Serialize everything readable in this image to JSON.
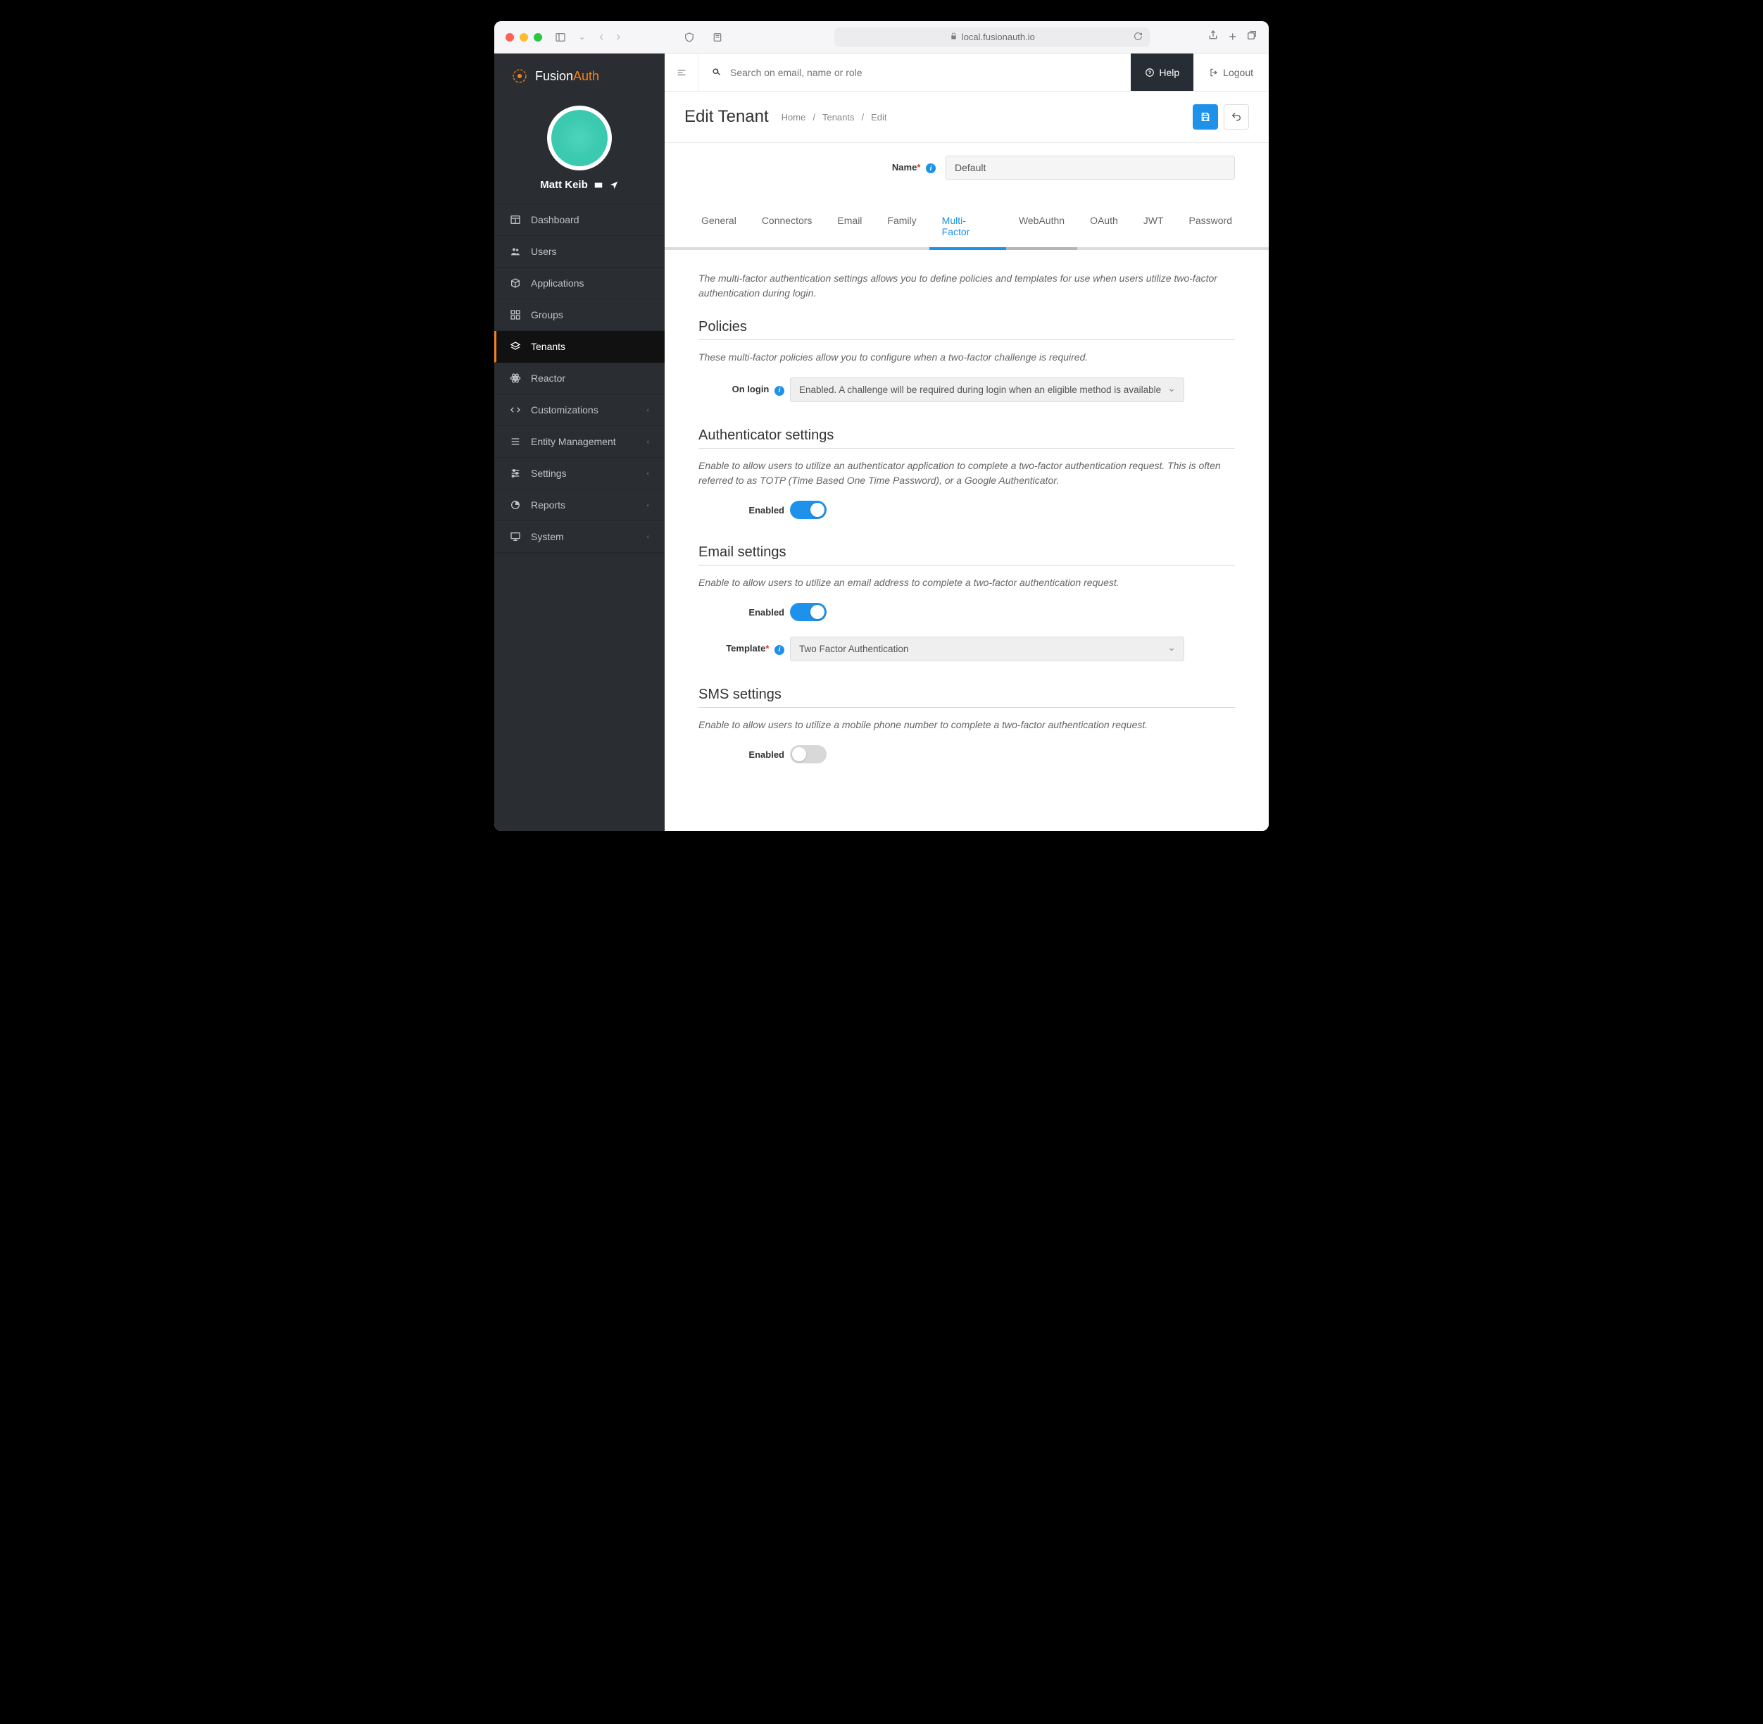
{
  "browser": {
    "url": "local.fusionauth.io"
  },
  "brand": {
    "name_left": "Fusion",
    "name_right": "Auth"
  },
  "user": {
    "name": "Matt Keib"
  },
  "sidebar": {
    "items": [
      {
        "label": "Dashboard",
        "icon": "dashboard"
      },
      {
        "label": "Users",
        "icon": "users"
      },
      {
        "label": "Applications",
        "icon": "cube"
      },
      {
        "label": "Groups",
        "icon": "groups"
      },
      {
        "label": "Tenants",
        "icon": "layers",
        "active": true
      },
      {
        "label": "Reactor",
        "icon": "reactor"
      },
      {
        "label": "Customizations",
        "icon": "code",
        "expandable": true
      },
      {
        "label": "Entity Management",
        "icon": "list",
        "expandable": true
      },
      {
        "label": "Settings",
        "icon": "sliders",
        "expandable": true
      },
      {
        "label": "Reports",
        "icon": "pie",
        "expandable": true
      },
      {
        "label": "System",
        "icon": "monitor",
        "expandable": true
      }
    ]
  },
  "topbar": {
    "search_placeholder": "Search on email, name or role",
    "help": "Help",
    "logout": "Logout"
  },
  "page": {
    "title": "Edit Tenant",
    "crumb_home": "Home",
    "crumb_tenants": "Tenants",
    "crumb_edit": "Edit"
  },
  "form": {
    "name_label": "Name",
    "name_value": "Default"
  },
  "tabs": [
    "General",
    "Connectors",
    "Email",
    "Family",
    "Multi-Factor",
    "WebAuthn",
    "OAuth",
    "JWT",
    "Password"
  ],
  "mfa": {
    "intro": "The multi-factor authentication settings allows you to define policies and templates for use when users utilize two-factor authentication during login.",
    "policies_title": "Policies",
    "policies_desc": "These multi-factor policies allow you to configure when a two-factor challenge is required.",
    "on_login_label": "On login",
    "on_login_value": "Enabled. A challenge will be required during login when an eligible method is available",
    "auth_title": "Authenticator settings",
    "auth_desc": "Enable to allow users to utilize an authenticator application to complete a two-factor authentication request. This is often referred to as TOTP (Time Based One Time Password), or a Google Authenticator.",
    "enabled_label": "Enabled",
    "email_title": "Email settings",
    "email_desc": "Enable to allow users to utilize an email address to complete a two-factor authentication request.",
    "template_label": "Template",
    "template_value": "Two Factor Authentication",
    "sms_title": "SMS settings",
    "sms_desc": "Enable to allow users to utilize a mobile phone number to complete a two-factor authentication request."
  }
}
